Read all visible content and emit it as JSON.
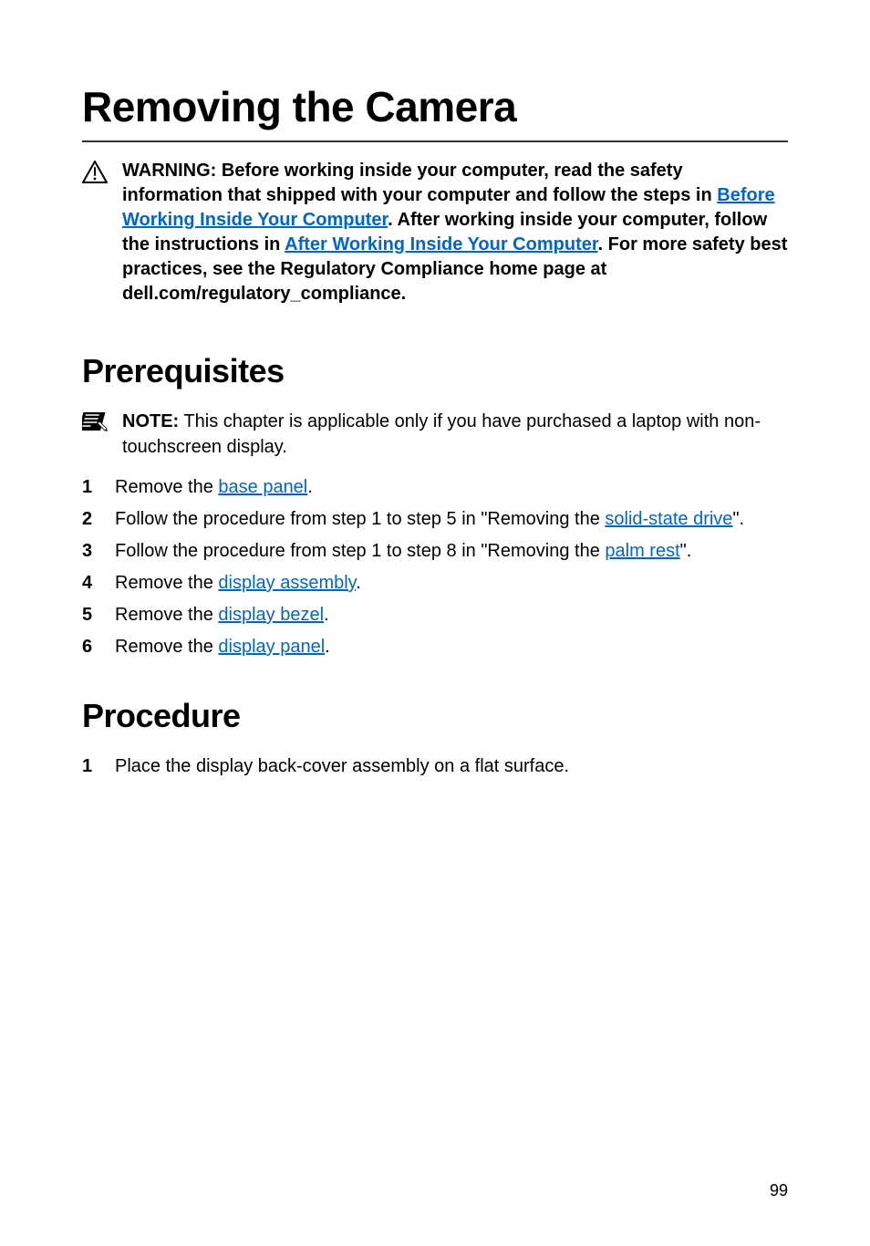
{
  "title": "Removing the Camera",
  "warning": {
    "prefix": "WARNING: Before working inside your computer, read the safety information that shipped with your computer and follow the steps in ",
    "link1": "Before Working Inside Your Computer",
    "mid1": ". After working inside your computer, follow the instructions in ",
    "link2": "After Working Inside Your Computer",
    "suffix": ". For more safety best practices, see the Regulatory Compliance home page at dell.com/regulatory_compliance."
  },
  "prerequisites": {
    "heading": "Prerequisites",
    "note": {
      "label": "NOTE:",
      "text": " This chapter is applicable only if you have purchased a laptop with non-touchscreen display."
    },
    "items": [
      {
        "num": "1",
        "parts": [
          {
            "t": "text",
            "v": "Remove the "
          },
          {
            "t": "link",
            "v": "base panel"
          },
          {
            "t": "text",
            "v": "."
          }
        ]
      },
      {
        "num": "2",
        "parts": [
          {
            "t": "text",
            "v": "Follow the procedure from step 1 to step 5 in \"Removing the "
          },
          {
            "t": "link",
            "v": "solid-state drive"
          },
          {
            "t": "text",
            "v": "\"."
          }
        ]
      },
      {
        "num": "3",
        "parts": [
          {
            "t": "text",
            "v": "Follow the procedure from step 1 to step 8 in \"Removing the "
          },
          {
            "t": "link",
            "v": "palm rest"
          },
          {
            "t": "text",
            "v": "\"."
          }
        ]
      },
      {
        "num": "4",
        "parts": [
          {
            "t": "text",
            "v": "Remove the "
          },
          {
            "t": "link",
            "v": "display assembly"
          },
          {
            "t": "text",
            "v": "."
          }
        ]
      },
      {
        "num": "5",
        "parts": [
          {
            "t": "text",
            "v": "Remove the "
          },
          {
            "t": "link",
            "v": "display bezel"
          },
          {
            "t": "text",
            "v": "."
          }
        ]
      },
      {
        "num": "6",
        "parts": [
          {
            "t": "text",
            "v": "Remove the "
          },
          {
            "t": "link",
            "v": "display panel"
          },
          {
            "t": "text",
            "v": "."
          }
        ]
      }
    ]
  },
  "procedure": {
    "heading": "Procedure",
    "items": [
      {
        "num": "1",
        "parts": [
          {
            "t": "text",
            "v": "Place the display back-cover assembly on a flat surface."
          }
        ]
      }
    ]
  },
  "page_number": "99"
}
